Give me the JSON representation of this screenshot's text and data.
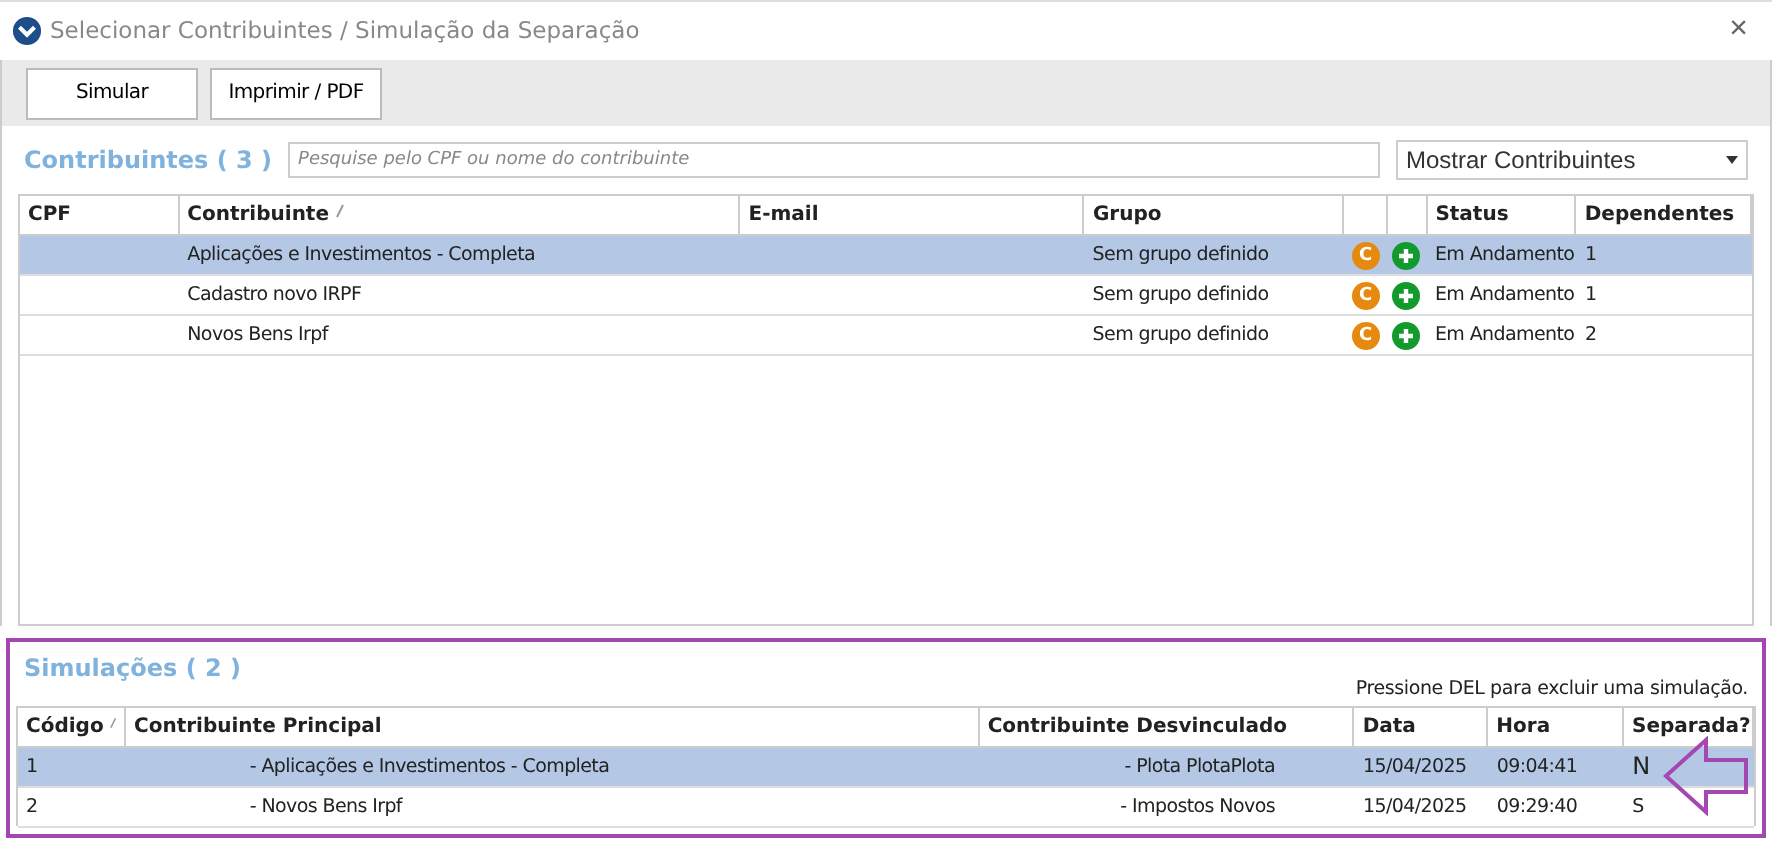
{
  "window": {
    "title": "Selecionar Contribuintes / Simulação da Separação",
    "close": "×"
  },
  "toolbar": {
    "buttons": [
      "Simular",
      "Imprimir / PDF"
    ]
  },
  "contribuintes": {
    "heading": "Contribuintes ( 3 )",
    "search": {
      "placeholder": "Pesquise pelo CPF ou nome do contribuinte"
    },
    "filter": {
      "value": "Mostrar Contribuintes"
    },
    "table": {
      "columns": [
        {
          "label": "CPF",
          "sorted": false
        },
        {
          "label": "Contribuinte",
          "sorted": true
        },
        {
          "label": "E-mail",
          "sorted": false
        },
        {
          "label": "Grupo",
          "sorted": false
        },
        {
          "kind": "badge",
          "sorted": false
        },
        {
          "kind": "add",
          "sorted": false
        },
        {
          "label": "Status",
          "sorted": false
        },
        {
          "label": "Dependentes",
          "sorted": false
        }
      ],
      "rows": [
        {
          "selected": true,
          "contribuinte": "Aplicações e Investimentos - Completa",
          "grupo": "Sem grupo definido",
          "badge": "C",
          "status": "Em Andamento",
          "dependentes": "1"
        },
        {
          "selected": false,
          "contribuinte": "Cadastro novo IRPF",
          "grupo": "Sem grupo definido",
          "badge": "C",
          "status": "Em Andamento",
          "dependentes": "1"
        },
        {
          "selected": false,
          "contribuinte": "Novos Bens Irpf",
          "grupo": "Sem grupo definido",
          "badge": "C",
          "status": "Em Andamento",
          "dependentes": "2"
        }
      ]
    }
  },
  "simulacoes": {
    "heading": "Simulações ( 2 )",
    "hint": "Pressione DEL para excluir uma simulação.",
    "table": {
      "columns": [
        {
          "label": "Código",
          "sorted": true
        },
        {
          "label": "Contribuinte Principal",
          "sorted": false
        },
        {
          "label": "Contribuinte Desvinculado",
          "sorted": false
        },
        {
          "label": "Data",
          "sorted": false
        },
        {
          "label": "Hora",
          "sorted": false
        },
        {
          "label": "Separada?",
          "sorted": false
        }
      ],
      "rows": [
        {
          "selected": true,
          "codigo": "1",
          "principal": "- Aplicações e Investimentos - Completa",
          "desvinculado": "- Plota PlotaPlota",
          "data": "15/04/2025",
          "hora": "09:04:41",
          "separada": "N"
        },
        {
          "selected": false,
          "codigo": "2",
          "principal": "- Novos Bens Irpf",
          "desvinculado": "- Impostos Novos",
          "data": "15/04/2025",
          "hora": "09:29:40",
          "separada": "S"
        }
      ]
    }
  }
}
